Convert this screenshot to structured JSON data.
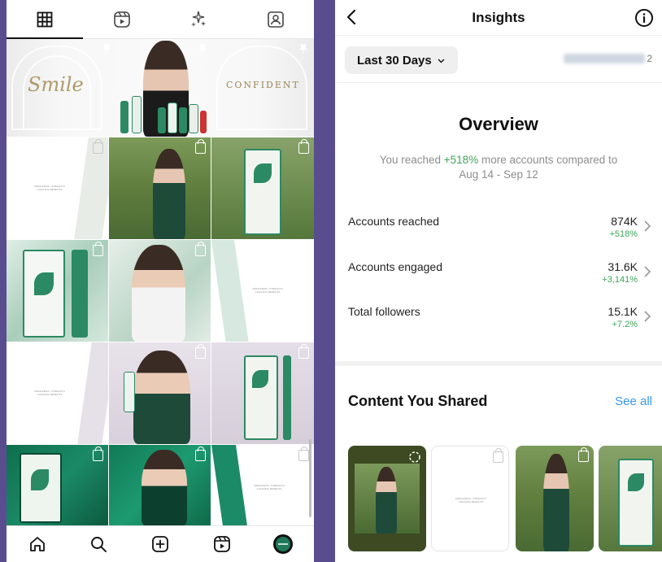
{
  "profile": {
    "tabs": [
      {
        "icon": "grid-icon"
      },
      {
        "icon": "reels-icon"
      },
      {
        "icon": "sparkle-icon"
      },
      {
        "icon": "tagged-icon"
      }
    ],
    "banner": {
      "left_text": "Smile",
      "right_text": "CONFIDENT"
    },
    "bottom_nav": [
      {
        "icon": "home-icon"
      },
      {
        "icon": "search-icon"
      },
      {
        "icon": "create-icon"
      },
      {
        "icon": "reels-icon"
      },
      {
        "icon": "profile-avatar-icon"
      }
    ]
  },
  "insights": {
    "title": "Insights",
    "date_range": "Last 30 Days",
    "account_suffix": "2",
    "overview": {
      "title": "Overview",
      "reach_prefix": "You reached ",
      "reach_pct": "+518%",
      "reach_suffix": " more accounts compared to",
      "compare_range": "Aug 14 - Sep 12"
    },
    "metrics": [
      {
        "label": "Accounts reached",
        "value": "874K",
        "change": "+518%"
      },
      {
        "label": "Accounts engaged",
        "value": "31.6K",
        "change": "+3,141%"
      },
      {
        "label": "Total followers",
        "value": "15.1K",
        "change": "+7.2%"
      }
    ],
    "shared": {
      "title": "Content You Shared",
      "see_all": "See all"
    }
  },
  "colors": {
    "background": "#5a4d8f",
    "positive": "#3aa757",
    "link": "#3897f0",
    "brand_green": "#1f7a5a"
  }
}
